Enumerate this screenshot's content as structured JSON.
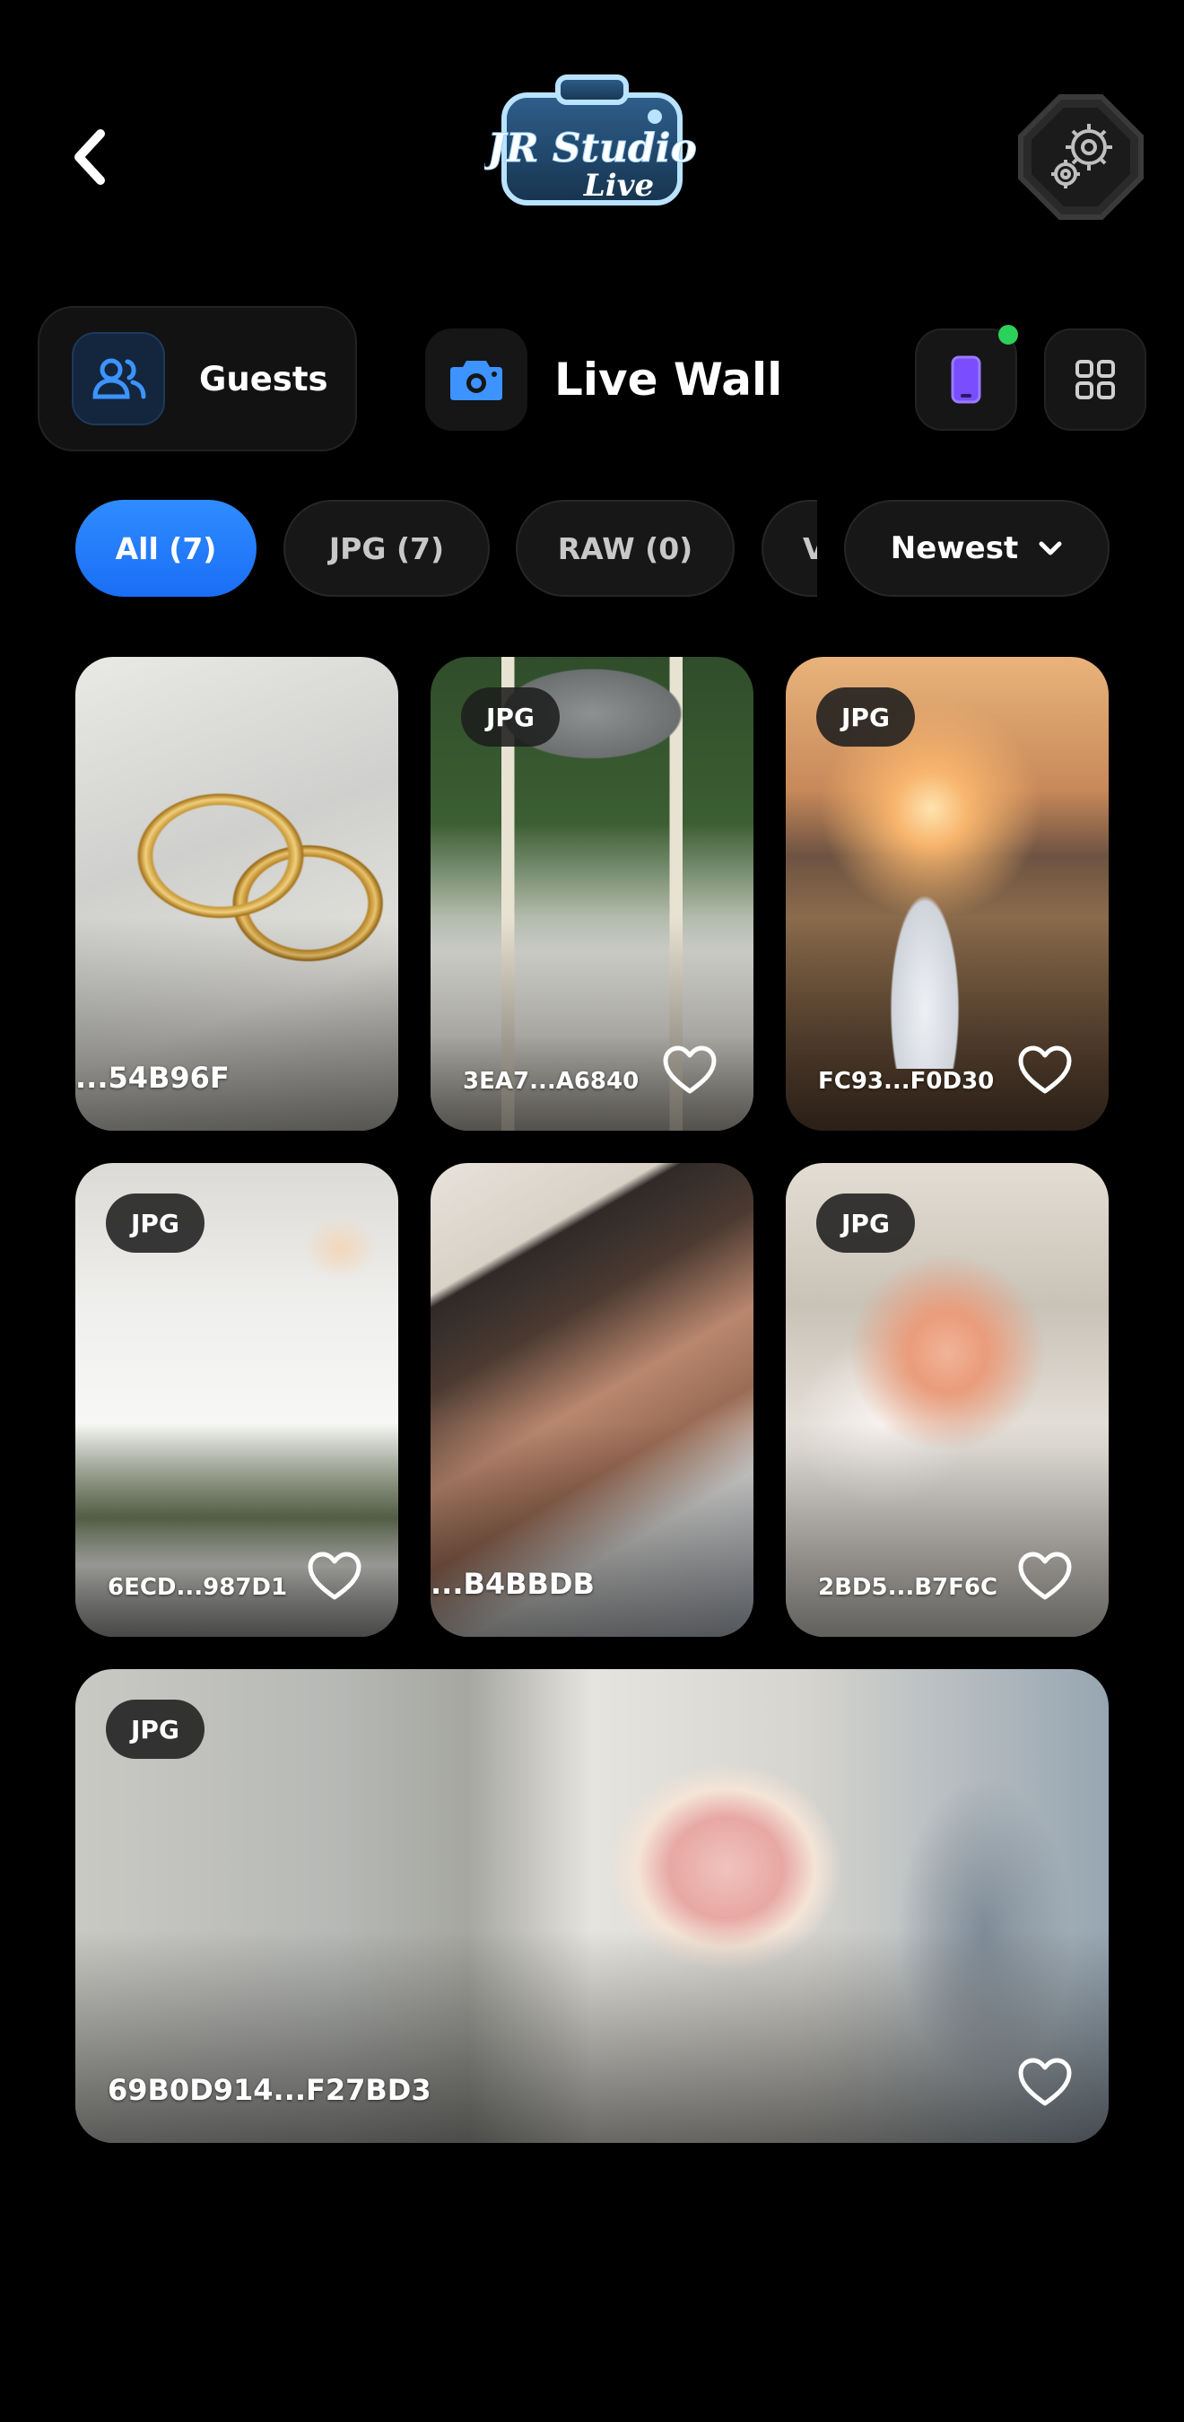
{
  "header": {
    "logo_text": "JR Studio Live",
    "back_icon": "chevron-left-icon",
    "settings_icon": "gear-icon"
  },
  "toolbar": {
    "guests_label": "Guests",
    "title": "Live Wall",
    "status_color": "#2bd15a",
    "accent_color": "#2f8cff"
  },
  "filters": {
    "all": "All (7)",
    "jpg": "JPG (7)",
    "raw": "RAW (0)",
    "partial": "V",
    "sort": "Newest"
  },
  "photos": [
    {
      "badge": "",
      "name": "...54B96F",
      "favorite": false
    },
    {
      "badge": "JPG",
      "name": "3EA7...A6840",
      "favorite": true
    },
    {
      "badge": "JPG",
      "name": "FC93...F0D30",
      "favorite": true
    },
    {
      "badge": "JPG",
      "name": "6ECD...987D1",
      "favorite": true
    },
    {
      "badge": "",
      "name": "...B4BBDB",
      "favorite": false
    },
    {
      "badge": "JPG",
      "name": "2BD5...B7F6C",
      "favorite": true
    },
    {
      "badge": "JPG",
      "name": "69B0D914...F27BD3",
      "favorite": true
    }
  ]
}
